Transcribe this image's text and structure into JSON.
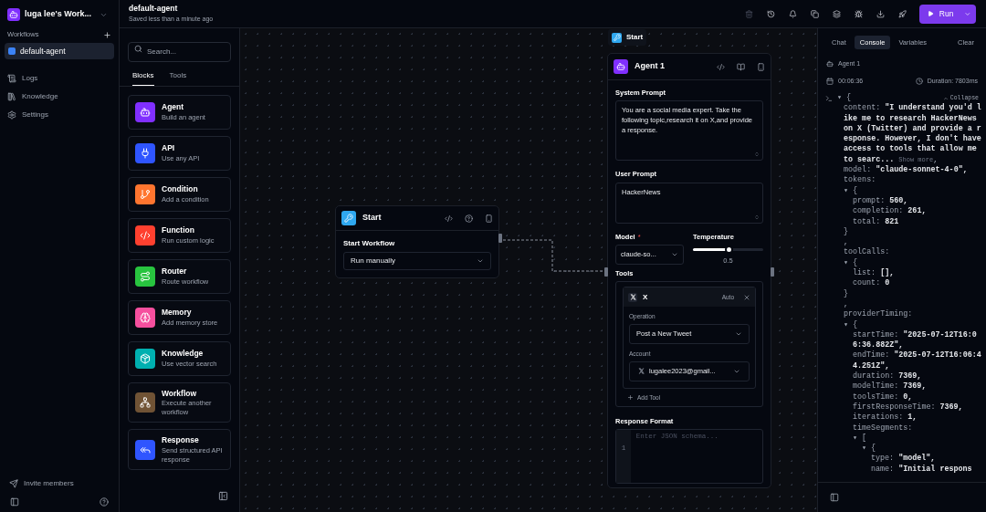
{
  "workspace": {
    "name": "luga lee's Work..."
  },
  "sidebar": {
    "section": "Workflows",
    "workflows": [
      {
        "label": "default-agent",
        "selected": true,
        "color": "#3b82f6"
      }
    ],
    "nav": [
      {
        "label": "Logs"
      },
      {
        "label": "Knowledge"
      },
      {
        "label": "Settings"
      }
    ],
    "invite": "Invite members"
  },
  "header": {
    "title": "default-agent",
    "subtitle": "Saved less than a minute ago",
    "delete_disabled": true,
    "run": "Run"
  },
  "blocks_panel": {
    "search_placeholder": "Search...",
    "tabs": [
      {
        "label": "Blocks",
        "selected": true
      },
      {
        "label": "Tools",
        "selected": false
      }
    ],
    "blocks": [
      {
        "name": "Agent",
        "description": "Build an agent",
        "color": "#802fff"
      },
      {
        "name": "API",
        "description": "Use any API",
        "color": "#2f55ff"
      },
      {
        "name": "Condition",
        "description": "Add a condition",
        "color": "#ff752f"
      },
      {
        "name": "Function",
        "description": "Run custom logic",
        "color": "#ff402f"
      },
      {
        "name": "Router",
        "description": "Route workflow",
        "color": "#28c43f"
      },
      {
        "name": "Memory",
        "description": "Add memory store",
        "color": "#f64f9e"
      },
      {
        "name": "Knowledge",
        "description": "Use vector search",
        "color": "#00b0b0"
      },
      {
        "name": "Workflow",
        "description": "Execute another workflow",
        "color": "#705335"
      },
      {
        "name": "Response",
        "description": "Send structured API response",
        "color": "#2f55ff"
      }
    ]
  },
  "canvas": {
    "start_tag": "Start",
    "start_node": {
      "title": "Start",
      "field_label": "Start Workflow",
      "trigger": "Run manually"
    },
    "agent_node": {
      "title": "Agent 1",
      "system_prompt_label": "System Prompt",
      "system_prompt": "You are a social media expert. Take the following topic,research it on X,and provide a response.",
      "user_prompt_label": "User Prompt",
      "user_prompt": "HackerNews",
      "model_label": "Model",
      "model_required": "*",
      "model": "claude-so...",
      "temperature_label": "Temperature",
      "temperature": {
        "level": 0.5,
        "reading": "0.5"
      },
      "tools_label": "Tools",
      "tool": {
        "name": "X",
        "mode": "Auto",
        "operation_label": "Operation",
        "operation": "Post a New Tweet",
        "account_label": "Account",
        "account": "lugalee2023@gmail..."
      },
      "add_tool": "Add Tool",
      "response_format_label": "Response Format",
      "line_number": "1",
      "response_format_placeholder": "Enter JSON schema..."
    }
  },
  "console": {
    "tabs": [
      {
        "label": "Chat",
        "selected": false
      },
      {
        "label": "Console",
        "selected": true
      },
      {
        "label": "Variables",
        "selected": false
      }
    ],
    "clear": "Clear",
    "block": "Agent 1",
    "time": "00:06:36",
    "duration": "Duration: 7803ms",
    "root": {
      "open": "▾ {",
      "collapse": "Collapse",
      "entries": [
        {
          "key": "content:",
          "value": "\"I understand you'd like me to research HackerNews on X (Twitter) and provide a response. However, I don't have access to tools that allow me to searc...",
          "more": "Show more",
          "after": ","
        },
        {
          "key": "model:",
          "value": "\"claude-sonnet-4-0\","
        },
        {
          "key": "tokens:",
          "open": "▾ {",
          "children": [
            {
              "key": "prompt:",
              "value": "560,"
            },
            {
              "key": "completion:",
              "value": "261,"
            },
            {
              "key": "total:",
              "value": "821"
            }
          ],
          "close": "}",
          "sep": ","
        },
        {
          "key": "toolCalls:",
          "open": "▾ {",
          "children": [
            {
              "key": "list:",
              "value": "[],"
            },
            {
              "key": "count:",
              "value": "0"
            }
          ],
          "close": "}",
          "sep": ","
        },
        {
          "key": "providerTiming:",
          "open": "▾ {",
          "children": [
            {
              "key": "startTime:",
              "value": "\"2025-07-12T16:06:36.882Z\","
            },
            {
              "key": "endTime:",
              "value": "\"2025-07-12T16:06:44.251Z\","
            },
            {
              "key": "duration:",
              "value": "7369,"
            },
            {
              "key": "modelTime:",
              "value": "7369,"
            },
            {
              "key": "toolsTime:",
              "value": "0,"
            },
            {
              "key": "firstResponseTime:",
              "value": "7369,"
            },
            {
              "key": "iterations:",
              "value": "1,"
            },
            {
              "key": "timeSegments:",
              "open": "▾ [",
              "children": [
                {
                  "open": "▾ {",
                  "children": [
                    {
                      "key": "type:",
                      "value": "\"model\","
                    },
                    {
                      "key": "name:",
                      "value": "\"Initial respons"
                    }
                  ]
                }
              ]
            }
          ]
        }
      ]
    }
  }
}
